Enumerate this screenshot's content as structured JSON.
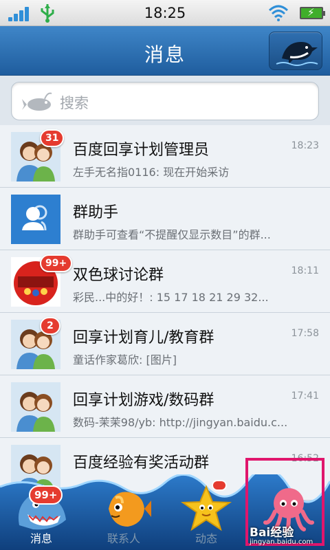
{
  "status_bar": {
    "time": "18:25"
  },
  "header": {
    "title": "消息"
  },
  "search": {
    "placeholder": "搜索"
  },
  "conversations": [
    {
      "name": "百度回享计划管理员",
      "preview": "左手无名指0116: 现在开始采访",
      "time": "18:23",
      "badge": "31",
      "avatar": "couple-avatar"
    },
    {
      "name": "群助手",
      "preview": "群助手可查看“不提醒仅显示数目”的群...",
      "time": "",
      "badge": "",
      "avatar": "group-helper-icon"
    },
    {
      "name": "双色球讨论群",
      "preview": "彩民...中的好！: 15 17 18 21 29 32...",
      "time": "18:11",
      "badge": "99+",
      "avatar": "lottery-avatar"
    },
    {
      "name": "回享计划育儿/教育群",
      "preview": "童话作家葛欣: [图片]",
      "time": "17:58",
      "badge": "2",
      "avatar": "couple-avatar"
    },
    {
      "name": "回享计划游戏/数码群",
      "preview": "数码-茉茉98/yb: http://jingyan.baidu.c...",
      "time": "17:41",
      "badge": "",
      "avatar": "couple-avatar"
    },
    {
      "name": "百度经验有奖活动群",
      "preview": "",
      "time": "16:52",
      "badge": "",
      "avatar": "couple-avatar"
    }
  ],
  "tabs": [
    {
      "label": "消息",
      "icon": "shark-icon",
      "badge": "99+",
      "color": "#ffffff"
    },
    {
      "label": "联系人",
      "icon": "fish-icon",
      "badge": "",
      "color": "#7e96ad"
    },
    {
      "label": "动态",
      "icon": "starfish-icon",
      "badge": "",
      "color": "#7e96ad"
    },
    {
      "label": "",
      "icon": "octopus-icon",
      "badge": "",
      "color": "#7e96ad"
    }
  ],
  "watermark": {
    "brand": "Bai经验",
    "url": "jingyan.baidu.com"
  },
  "colors": {
    "header": "#2a6fb3",
    "badge": "#e53b2f",
    "highlight": "#e0166c"
  }
}
